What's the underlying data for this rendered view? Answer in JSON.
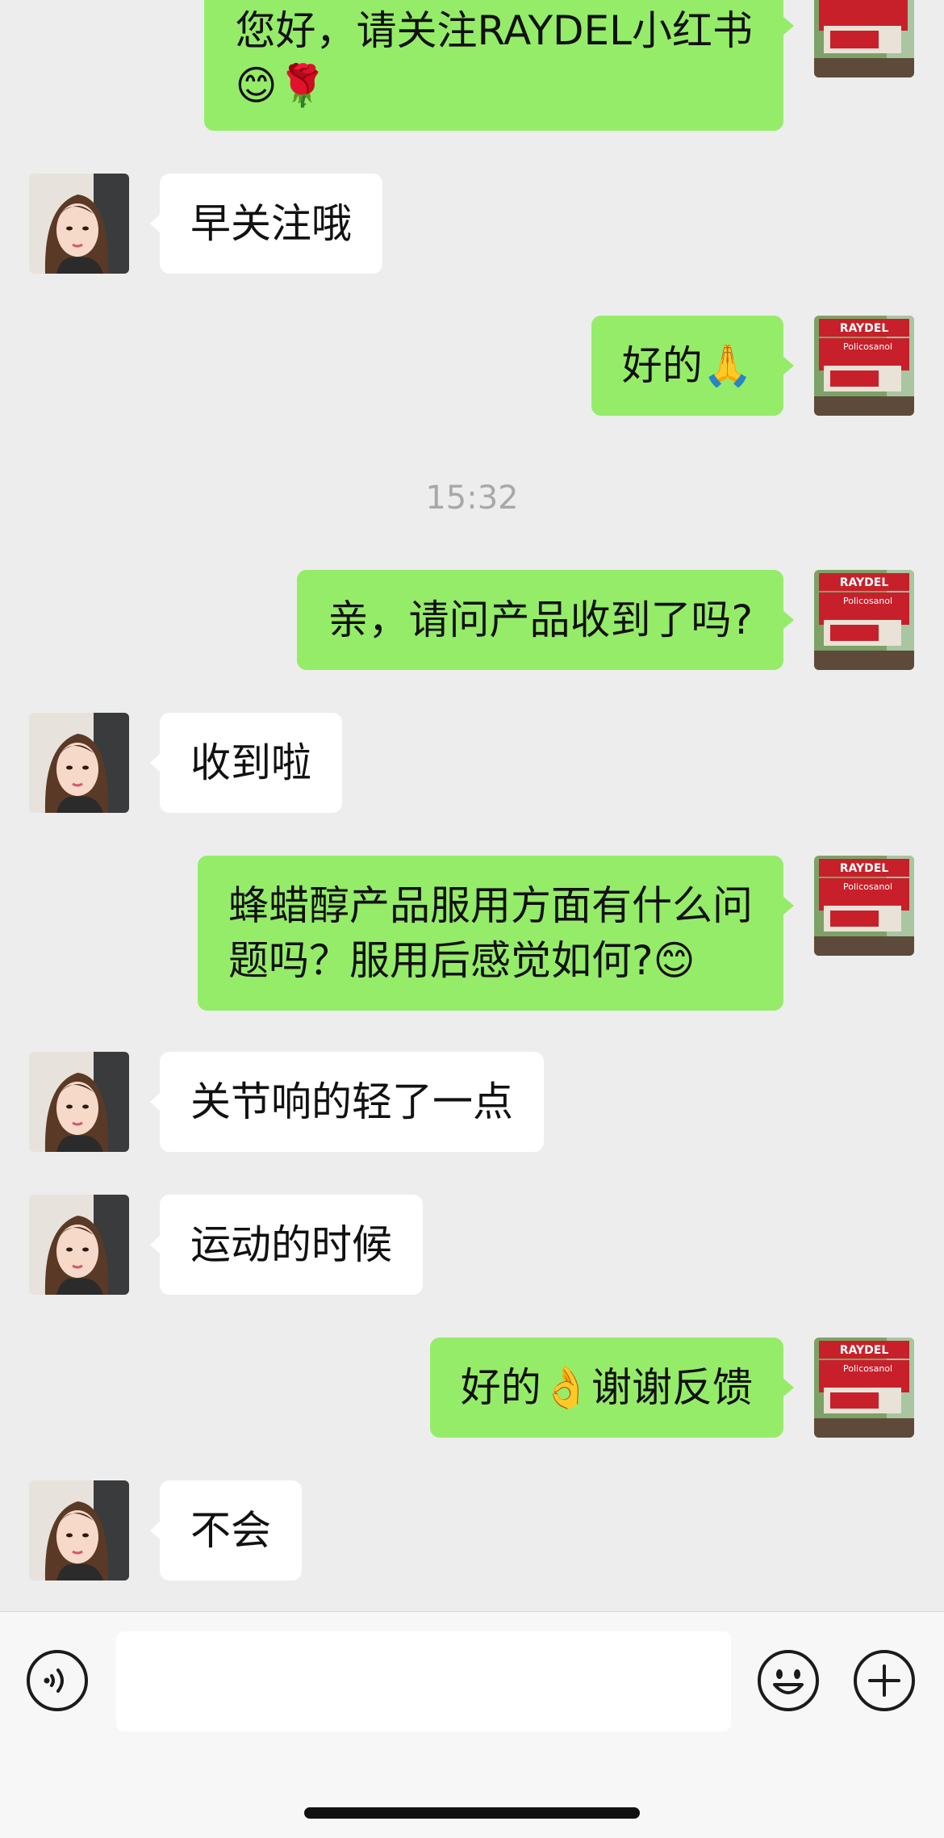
{
  "messages": [
    {
      "side": "right",
      "text": "您好，请关注RAYDEL小红书",
      "text2": "😊🌹"
    },
    {
      "side": "left",
      "text": "早关注哦"
    },
    {
      "side": "right",
      "text": "好的🙏"
    },
    {
      "side": "left",
      "text": "收到啦"
    },
    {
      "side": "right",
      "text": "亲，请问产品收到了吗?"
    },
    {
      "side": "right",
      "text": "蜂蜡醇产品服用方面有什么问",
      "text2": "题吗？服用后感觉如何?😊"
    },
    {
      "side": "left",
      "text": "关节响的轻了一点"
    },
    {
      "side": "left",
      "text": "运动的时候"
    },
    {
      "side": "right",
      "text": "好的👌谢谢反馈"
    },
    {
      "side": "left",
      "text": "不会"
    }
  ],
  "timestamp": "15:32",
  "product_avatar": {
    "brand": "RAYDEL",
    "subtitle": "Policosanol"
  },
  "input": {
    "value": "",
    "placeholder": ""
  },
  "colors": {
    "background": "#ededed",
    "bubble_self": "#95ec69",
    "bubble_other": "#ffffff",
    "brand_red": "#c8202a"
  },
  "icons": [
    "voice-icon",
    "emoji-icon",
    "plus-icon"
  ]
}
